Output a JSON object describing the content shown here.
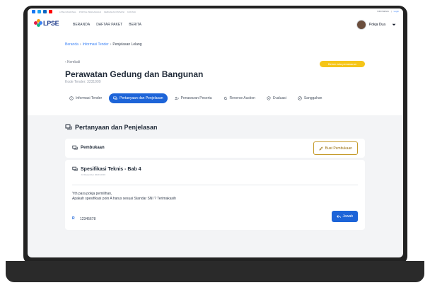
{
  "topbar": {
    "social": [
      {
        "name": "facebook-icon",
        "color": "#1877f2"
      },
      {
        "name": "twitter-icon",
        "color": "#1da1f2"
      },
      {
        "name": "linkedin-icon",
        "color": "#0a66c2"
      },
      {
        "name": "youtube-icon",
        "color": "#ff0000"
      }
    ],
    "links": [
      "LPSE NASIONAL",
      "PORTAL PENGADAAN",
      "KEBIJAKAN PRIVASI",
      "KONTAK"
    ],
    "language": "INDONESIA",
    "login": "Login"
  },
  "nav": {
    "logo": "LPSE",
    "menu": [
      "BERANDA",
      "DAFTAR PAKET",
      "BERITA"
    ],
    "user": "Pokja Dua"
  },
  "breadcrumb": [
    "Beranda",
    "Informasi Tender",
    "Penjelasan Lelang"
  ],
  "back_label": "Kembali",
  "status_badge": "Belum ada penawaran",
  "title": "Perawatan Gedung dan Bangunan",
  "kode_tender": "Kode Tender: 3231999",
  "tabs": [
    {
      "label": "Informasi Tender",
      "icon": "info-icon"
    },
    {
      "label": "Pertanyaan dan Penjelasan",
      "icon": "chat-icon",
      "active": true
    },
    {
      "label": "Penawaran Peserta",
      "icon": "users-icon"
    },
    {
      "label": "Reverse Auction",
      "icon": "refresh-icon"
    },
    {
      "label": "Evaluasi",
      "icon": "shield-check-icon"
    },
    {
      "label": "Sanggahan",
      "icon": "block-icon"
    }
  ],
  "section": {
    "title": "Pertanyaan dan Penjelasan"
  },
  "pembukaan": {
    "title": "Pembukaan",
    "button": "Buat Pembukaan"
  },
  "thread": {
    "title": "Spesifikasi Teknis - Bab 4",
    "date": "10 Desember 2020 10:00",
    "message_line1": "Yth para pokja pemilihan,",
    "message_line2": "Apakah spesifikasi poin A harus sesuai Standar SNI ? Terimakasih",
    "author": "12345678",
    "reply_button": "Jawab"
  },
  "colors": {
    "primary": "#1d64d8",
    "badge": "#f5c518",
    "outline_button": "#c49a2a"
  }
}
